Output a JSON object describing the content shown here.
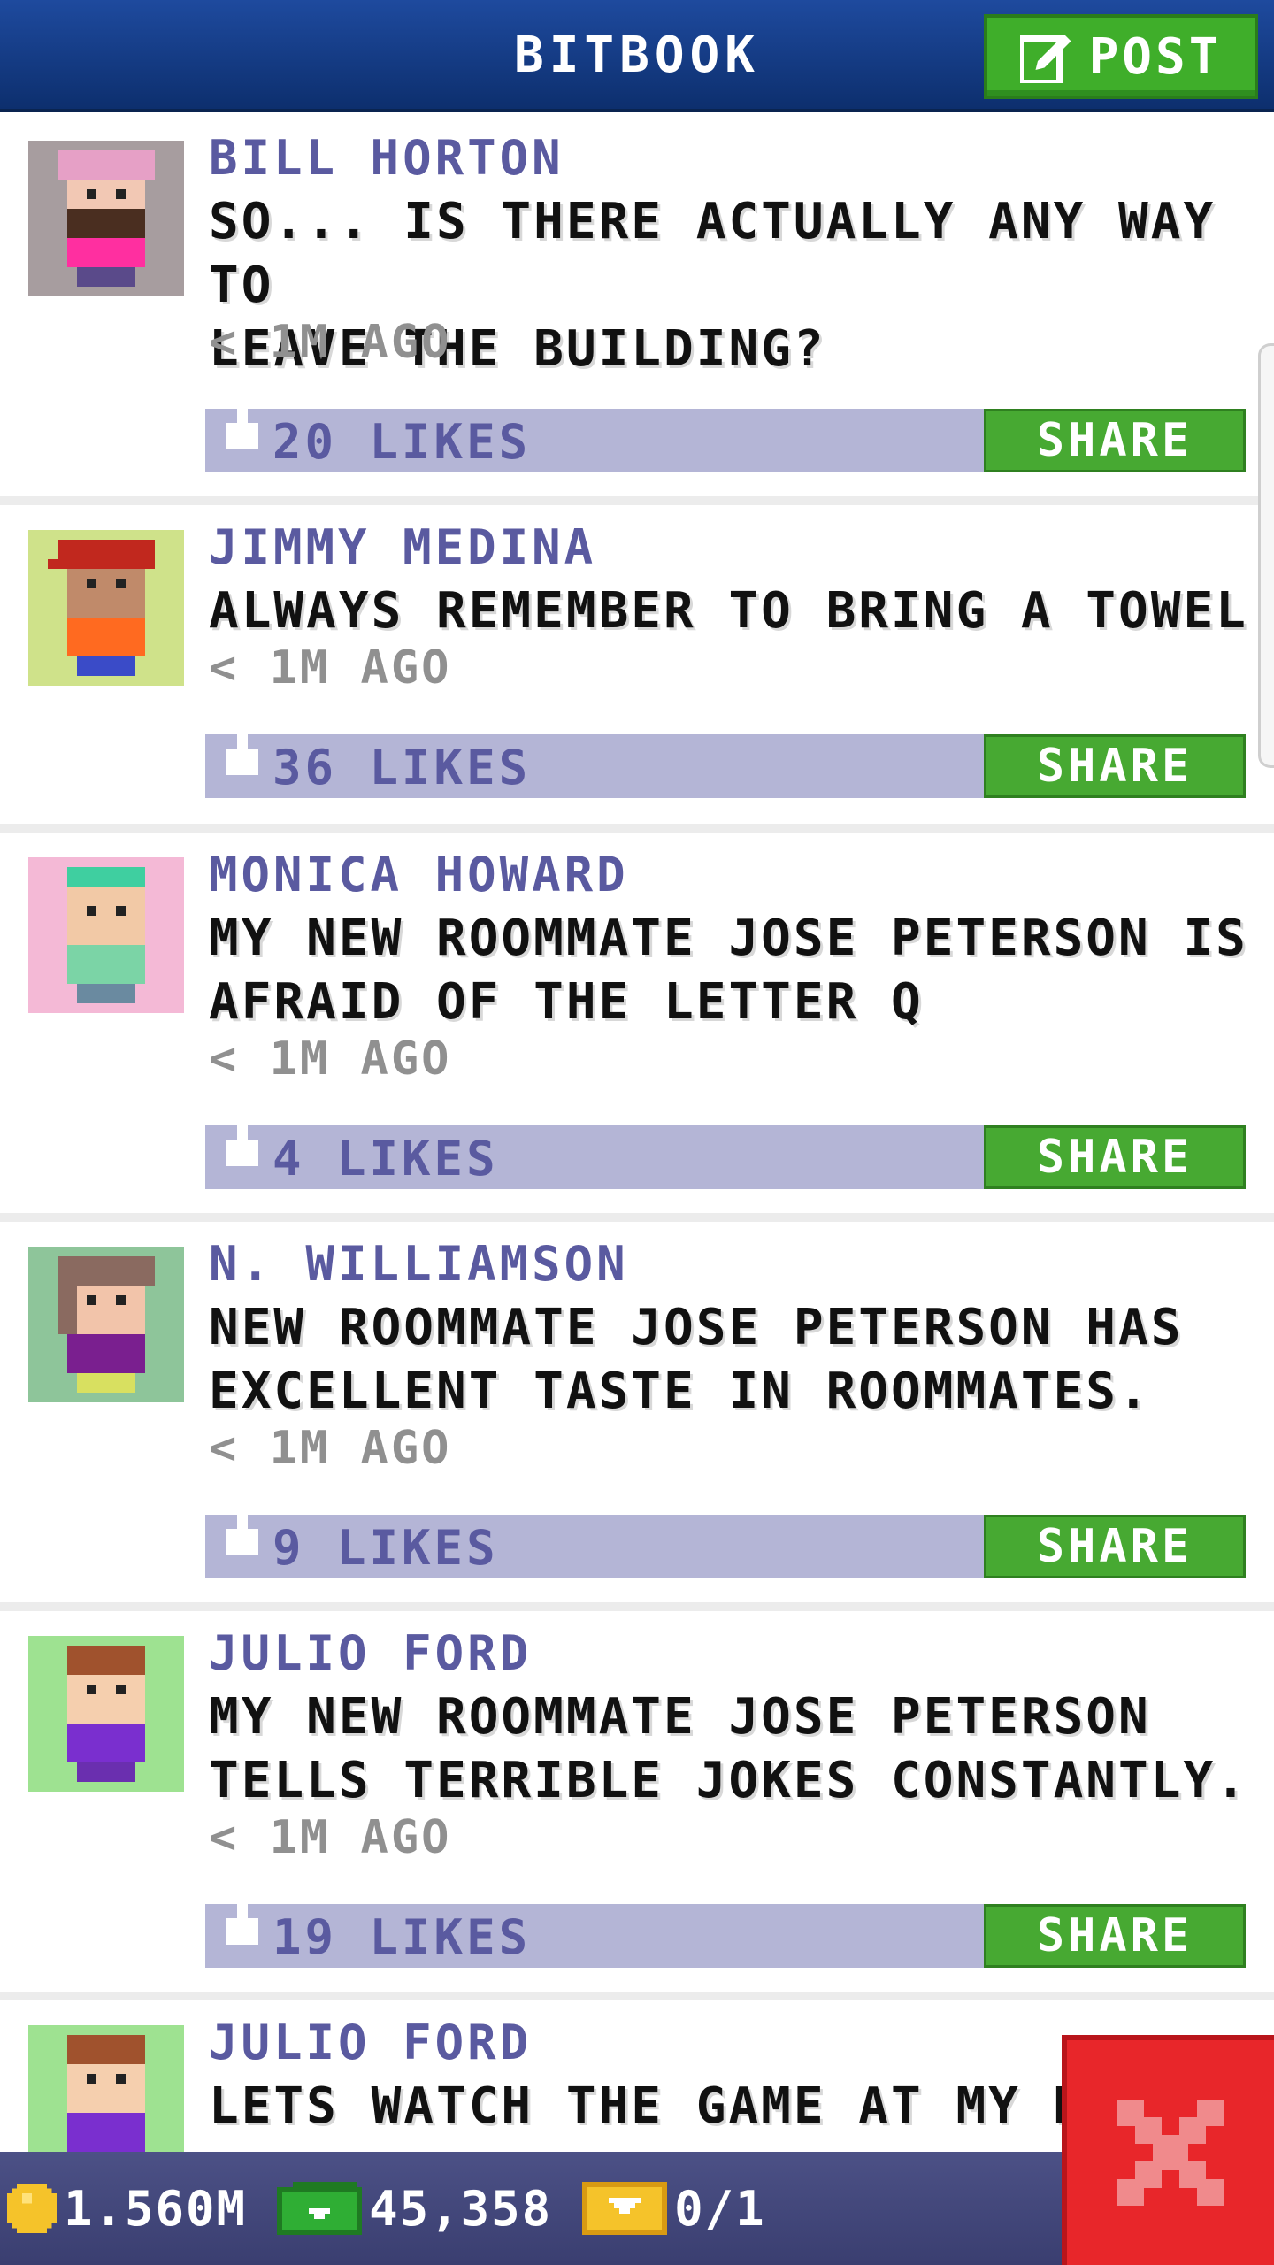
{
  "header": {
    "title": "BITBOOK",
    "post_label": "POST"
  },
  "posts": [
    {
      "author": "BILL HORTON",
      "lines": [
        "SO... IS THERE ACTUALLY ANY WAY TO",
        "LEAVE THE BUILDING?"
      ],
      "time": "< 1M AGO",
      "likes": "20 LIKES",
      "share": "SHARE",
      "avatar": {
        "bg": "#a79d9f",
        "hair": "#e6a0c6",
        "skin": "#f2c8b4",
        "shirt": "#ff2fa0",
        "pants": "#5a4a8a",
        "beard": "#4a2e20"
      }
    },
    {
      "author": "JIMMY MEDINA",
      "lines": [
        "ALWAYS REMEMBER TO BRING A TOWEL"
      ],
      "time": "< 1M AGO",
      "likes": "36 LIKES",
      "share": "SHARE",
      "avatar": {
        "bg": "#cfe28a",
        "hair": "#c1281e",
        "skin": "#c08a6a",
        "shirt": "#ff6a20",
        "pants": "#3a4bc8"
      }
    },
    {
      "author": "MONICA HOWARD",
      "lines": [
        "MY NEW ROOMMATE JOSE PETERSON IS",
        "AFRAID OF THE LETTER Q"
      ],
      "time": "< 1M AGO",
      "likes": "4 LIKES",
      "share": "SHARE",
      "avatar": {
        "bg": "#f4b9d6",
        "hair": "#3fcfa0",
        "skin": "#f2c9a6",
        "shirt": "#7bd4a6",
        "pants": "#6a8aa0"
      }
    },
    {
      "author": "N. WILLIAMSON",
      "lines": [
        "NEW ROOMMATE JOSE PETERSON HAS",
        "EXCELLENT TASTE IN ROOMMATES."
      ],
      "time": "< 1M AGO",
      "likes": "9 LIKES",
      "share": "SHARE",
      "avatar": {
        "bg": "#8ec59a",
        "hair": "#8a6a60",
        "skin": "#f2c4aa",
        "shirt": "#7a1f8f",
        "pants": "#d8e060"
      }
    },
    {
      "author": "JULIO FORD",
      "lines": [
        "MY NEW ROOMMATE JOSE PETERSON",
        "TELLS TERRIBLE JOKES CONSTANTLY."
      ],
      "time": "< 1M AGO",
      "likes": "19 LIKES",
      "share": "SHARE",
      "avatar": {
        "bg": "#9ee291",
        "hair": "#a0522d",
        "skin": "#f5cfae",
        "shirt": "#7a2fcf",
        "pants": "#6a2faf"
      }
    },
    {
      "author": "JULIO FORD",
      "lines": [
        "LETS WATCH THE GAME AT MY N"
      ],
      "time": "",
      "likes": "",
      "share": "",
      "avatar": {
        "bg": "#9ee291",
        "hair": "#a0522d",
        "skin": "#f5cfae",
        "shirt": "#7a2fcf",
        "pants": "#6a2faf"
      }
    }
  ],
  "footer": {
    "coins": "1.560M",
    "bux": "45,358",
    "tickets": "0/1"
  },
  "colors": {
    "header": "#1e4a9e",
    "share_green": "#47a932",
    "likes_bar": "#b4b5d6",
    "author_text": "#5a5aa0",
    "close_red": "#e8262a"
  }
}
